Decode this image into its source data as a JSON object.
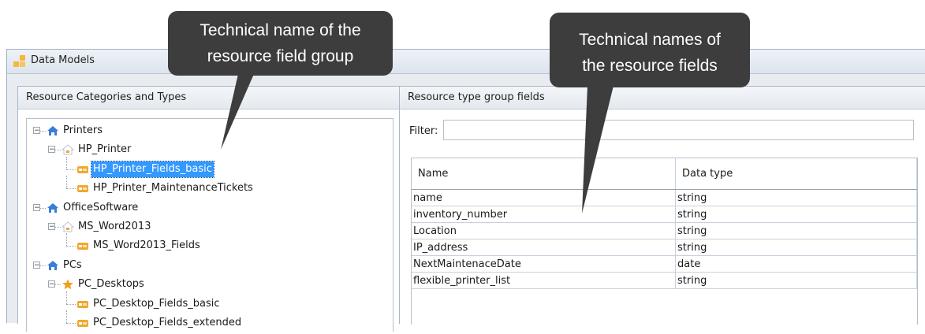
{
  "window": {
    "title": "Data Models"
  },
  "left_panel": {
    "header": "Resource Categories and Types",
    "tree": [
      {
        "label": "Printers",
        "icon": "house-icon",
        "level": 0,
        "expander": "minus"
      },
      {
        "label": "HP_Printer",
        "icon": "faded-house-icon",
        "level": 1,
        "expander": "minus"
      },
      {
        "label": "HP_Printer_Fields_basic",
        "icon": "field-group-icon",
        "level": 2,
        "selected": true
      },
      {
        "label": "HP_Printer_MaintenanceTickets",
        "icon": "field-group-icon",
        "level": 2
      },
      {
        "label": "OfficeSoftware",
        "icon": "house-icon",
        "level": 0,
        "expander": "minus"
      },
      {
        "label": "MS_Word2013",
        "icon": "faded-house-icon",
        "level": 1,
        "expander": "minus"
      },
      {
        "label": "MS_Word2013_Fields",
        "icon": "field-group-icon",
        "level": 2
      },
      {
        "label": "PCs",
        "icon": "house-icon",
        "level": 0,
        "expander": "minus"
      },
      {
        "label": "PC_Desktops",
        "icon": "star-icon",
        "level": 1,
        "expander": "minus"
      },
      {
        "label": "PC_Desktop_Fields_basic",
        "icon": "field-group-icon",
        "level": 2
      },
      {
        "label": "PC_Desktop_Fields_extended",
        "icon": "field-group-icon",
        "level": 2
      }
    ]
  },
  "right_panel": {
    "header": "Resource type group fields",
    "filter_label": "Filter:",
    "filter_value": "",
    "columns": [
      "Name",
      "Data type"
    ],
    "rows": [
      [
        "name",
        "string"
      ],
      [
        "inventory_number",
        "string"
      ],
      [
        "Location",
        "string"
      ],
      [
        "IP_address",
        "string"
      ],
      [
        "NextMaintenaceDate",
        "date"
      ],
      [
        "flexible_printer_list",
        "string"
      ]
    ]
  },
  "callouts": {
    "left": [
      "Technical name of the",
      "resource field group"
    ],
    "right": [
      "Technical names of",
      "the resource fields"
    ]
  },
  "colors": {
    "selection": "#3399ff",
    "callout_bg": "#3d3d3d",
    "house_icon": "#3a7dd8",
    "star_icon": "#f0a020",
    "field_icon": "#f0a830"
  }
}
